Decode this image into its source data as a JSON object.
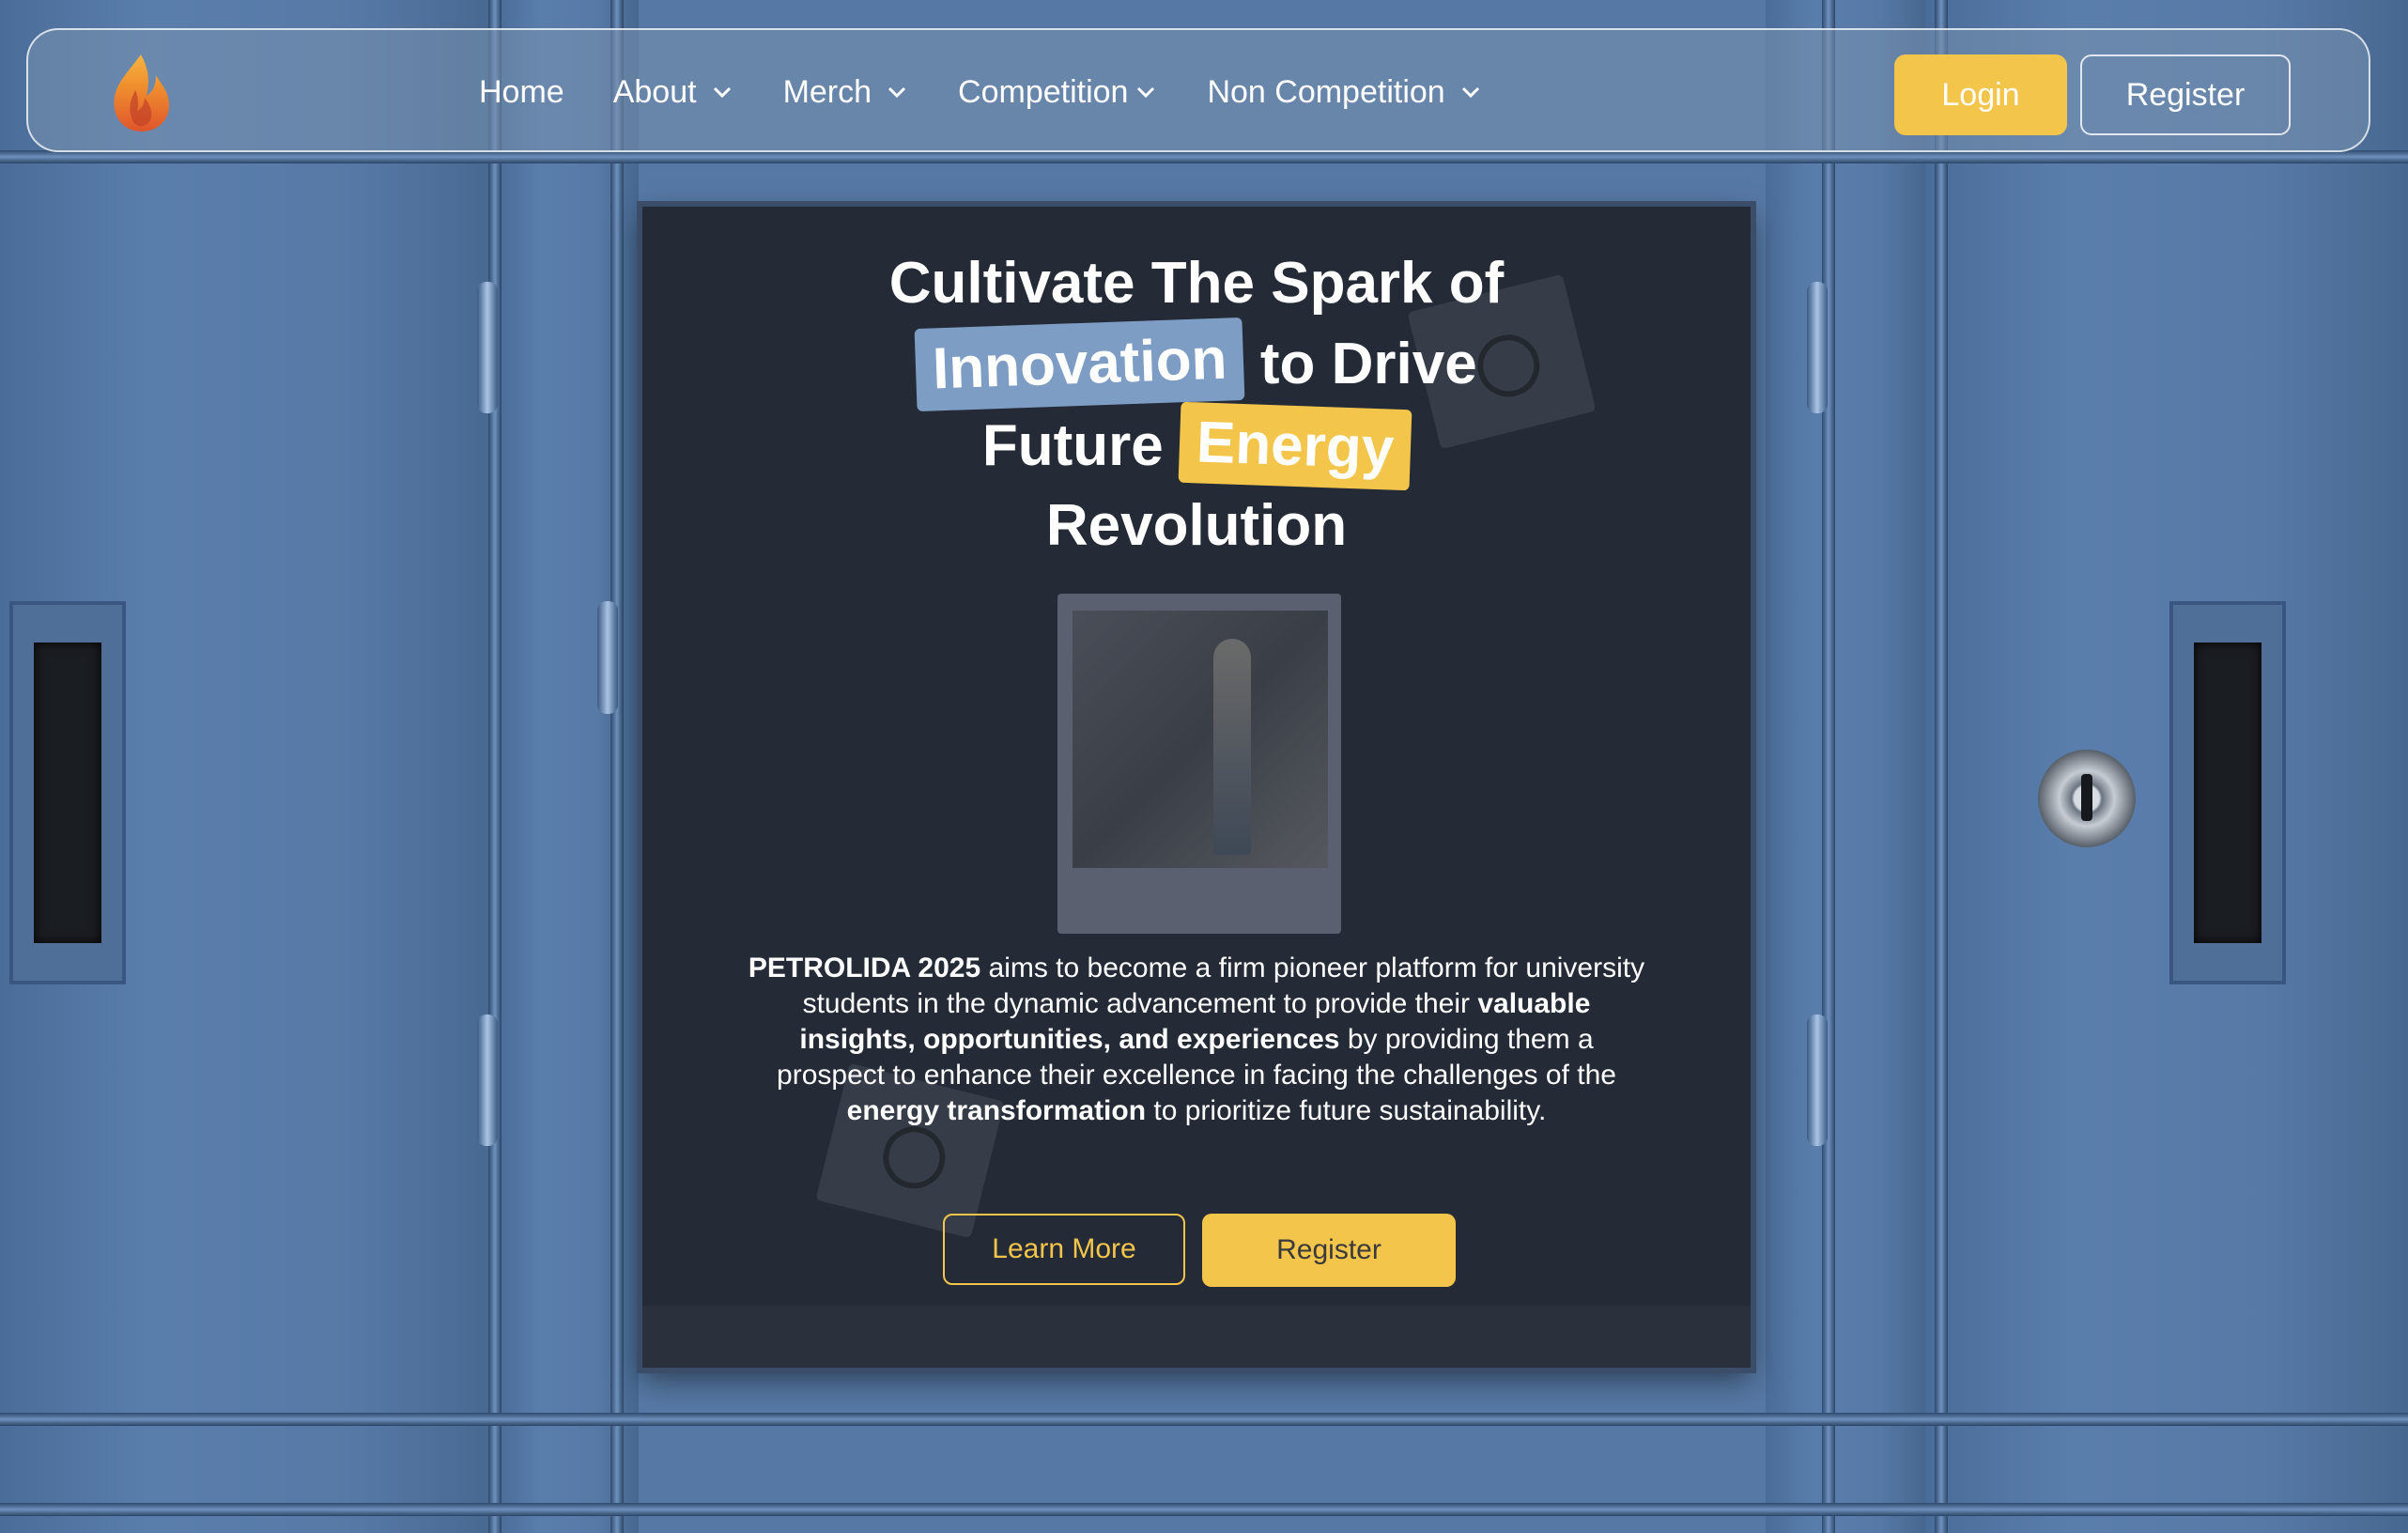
{
  "nav": {
    "items": [
      {
        "label": "Home",
        "has_dropdown": false
      },
      {
        "label": "About",
        "has_dropdown": true
      },
      {
        "label": "Merch",
        "has_dropdown": true
      },
      {
        "label": "Competition",
        "has_dropdown": true
      },
      {
        "label": "Non Competition",
        "has_dropdown": true
      }
    ],
    "login_label": "Login",
    "register_label": "Register"
  },
  "hero": {
    "line1": "Cultivate The Spark of",
    "highlight_blue": "Innovation",
    "line2_rest": "to Drive",
    "line3_start": "Future",
    "highlight_yellow": "Energy",
    "line4": "Revolution",
    "desc": {
      "p1_bold": "PETROLIDA 2025",
      "p1": " aims to become a firm pioneer platform for university students in the dynamic advancement to provide their ",
      "p2_bold": "valuable insights, opportunities, and experiences",
      "p2": " by providing them a prospect to enhance their excellence in facing the challenges of the ",
      "p3_bold": "energy transformation",
      "p3": " to prioritize future sustainability."
    },
    "learn_more_label": "Learn More",
    "register_label": "Register"
  },
  "colors": {
    "accent_yellow": "#f4c54b",
    "accent_blue": "#7e9dc5",
    "panel_dark": "#242a36"
  },
  "icons": {
    "logo": "flame-logo-icon",
    "dropdown": "chevron-down-icon"
  }
}
